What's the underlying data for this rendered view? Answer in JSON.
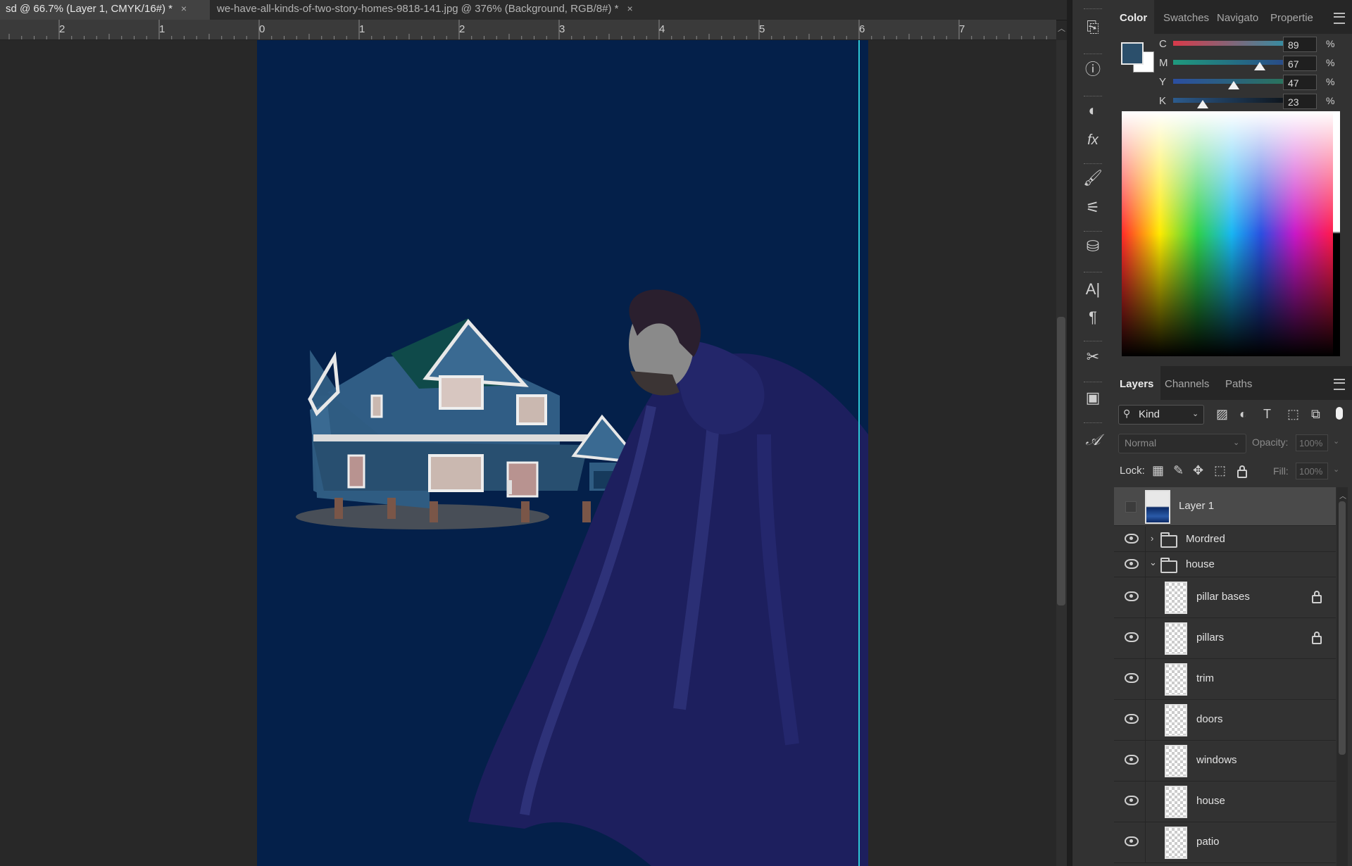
{
  "tabs": [
    {
      "label": "sd @ 66.7% (Layer 1, CMYK/16#) *",
      "close": "×"
    },
    {
      "label": "we-have-all-kinds-of-two-story-homes-9818-141.jpg @ 376% (Background, RGB/8#) *",
      "close": "×"
    }
  ],
  "ruler": {
    "labels": [
      "2",
      "1",
      "0",
      "1",
      "2",
      "3",
      "4",
      "5",
      "6",
      "7"
    ]
  },
  "color_panel": {
    "tabs": [
      "Color",
      "Swatches",
      "Navigato",
      "Propertie"
    ],
    "foreground_color": "#2b4f6b",
    "background_color": "#ffffff",
    "channels": [
      {
        "label": "C",
        "value": "89",
        "unit": "%",
        "level": 0.89,
        "track": "linear-gradient(to right,#d83a4a,#1b9ab0)"
      },
      {
        "label": "M",
        "value": "67",
        "unit": "%",
        "level": 0.67,
        "track": "linear-gradient(to right,#1f9a7d,#2a3e8a)"
      },
      {
        "label": "Y",
        "value": "47",
        "unit": "%",
        "level": 0.47,
        "track": "linear-gradient(to right,#2b4ea0,#2a7a52)"
      },
      {
        "label": "K",
        "value": "23",
        "unit": "%",
        "level": 0.23,
        "track": "linear-gradient(to right,#2c5b8d,#0a0a0a)"
      }
    ]
  },
  "layers_panel": {
    "tabs": [
      "Layers",
      "Channels",
      "Paths"
    ],
    "filter_label": "Kind",
    "blend_mode": "Normal",
    "opacity_label": "Opacity:",
    "opacity_value": "100%",
    "lock_label": "Lock:",
    "fill_label": "Fill:",
    "fill_value": "100%",
    "layers": [
      {
        "name": "Layer 1",
        "type": "layer",
        "selected": true,
        "visible": false
      },
      {
        "name": "Mordred",
        "type": "group",
        "expanded": false,
        "visible": true
      },
      {
        "name": "house",
        "type": "group",
        "expanded": true,
        "visible": true
      },
      {
        "name": "pillar bases",
        "type": "child",
        "locked": true,
        "visible": true
      },
      {
        "name": "pillars",
        "type": "child",
        "locked": true,
        "visible": true
      },
      {
        "name": "trim",
        "type": "child",
        "locked": false,
        "visible": true
      },
      {
        "name": "doors",
        "type": "child",
        "locked": false,
        "visible": true
      },
      {
        "name": "windows",
        "type": "child",
        "locked": false,
        "visible": true
      },
      {
        "name": "house",
        "type": "child",
        "locked": false,
        "visible": true
      },
      {
        "name": "patio",
        "type": "child",
        "locked": false,
        "visible": true
      }
    ]
  },
  "canvas": {
    "background": "#04204a"
  }
}
